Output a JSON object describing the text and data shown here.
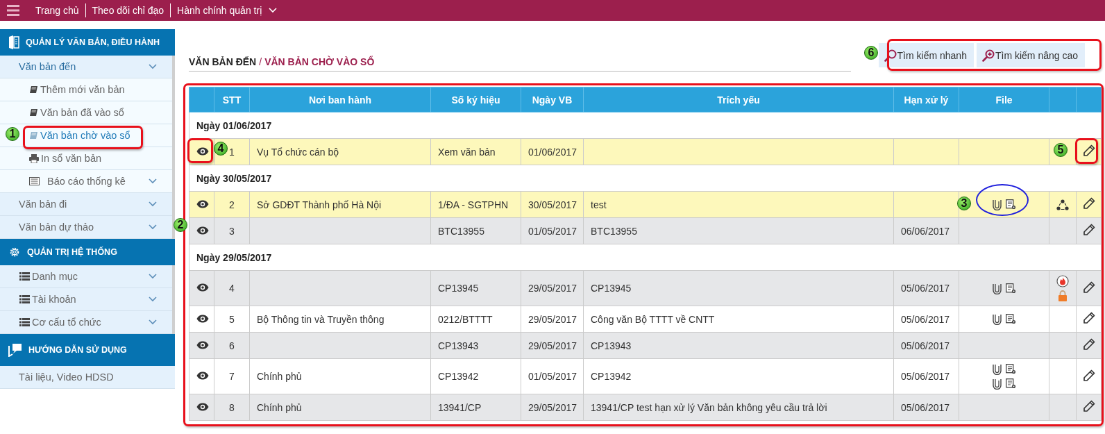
{
  "topbar": {
    "menu_items": [
      {
        "label": "Trang chủ",
        "dropdown": false
      },
      {
        "label": "Theo dõi chỉ đạo",
        "dropdown": false
      },
      {
        "label": "Hành chính quản trị",
        "dropdown": true
      }
    ]
  },
  "sidebar": {
    "sections": [
      {
        "kind": "documents",
        "title": "QUẢN LÝ VĂN BẢN, ĐIỀU HÀNH",
        "items": [
          {
            "label": "Văn bản đến",
            "kind": "plain",
            "expandable": true,
            "expanded": true,
            "selected": false,
            "children": [
              {
                "label": "Thêm mới văn bản",
                "kind": "document",
                "expandable": false,
                "selected": false
              },
              {
                "label": "Văn bản đã vào sổ",
                "kind": "document",
                "expandable": false,
                "selected": false
              },
              {
                "label": "Văn bản chờ vào sổ",
                "kind": "document",
                "expandable": false,
                "selected": true
              },
              {
                "label": "In sổ văn bản",
                "kind": "print",
                "expandable": false,
                "selected": false
              },
              {
                "label": "Báo cáo thống kê",
                "kind": "report",
                "expandable": true,
                "selected": false
              }
            ]
          },
          {
            "label": "Văn bản đi",
            "kind": "plain",
            "expandable": true,
            "expanded": false,
            "selected": false
          },
          {
            "label": "Văn bản dự thảo",
            "kind": "plain",
            "expandable": true,
            "expanded": false,
            "selected": false
          }
        ]
      },
      {
        "kind": "settings",
        "title": "QUẢN TRỊ HỆ THỐNG",
        "items": [
          {
            "label": "Danh mục",
            "kind": "list",
            "expandable": true,
            "expanded": false,
            "selected": false
          },
          {
            "label": "Tài khoản",
            "kind": "list",
            "expandable": true,
            "expanded": false,
            "selected": false
          },
          {
            "label": "Cơ cấu tổ chức",
            "kind": "list",
            "expandable": true,
            "expanded": false,
            "selected": false
          }
        ]
      },
      {
        "kind": "guide",
        "title": "HƯỚNG DẪN SỬ DỤNG",
        "items": [
          {
            "label": "Tài liệu, Video HDSD",
            "kind": "plain",
            "expandable": false,
            "expanded": false,
            "selected": false
          }
        ]
      }
    ]
  },
  "breadcrumb": {
    "parent": "VĂN BẢN ĐẾN",
    "separator": "/",
    "current": "VĂN BẢN CHỜ VÀO SỔ"
  },
  "search_buttons": [
    {
      "kind": "quick",
      "label": "Tìm kiếm nhanh"
    },
    {
      "kind": "advanced",
      "label": "Tìm kiếm nâng cao"
    }
  ],
  "table": {
    "columns": [
      "STT",
      "Nơi ban hành",
      "Số ký hiệu",
      "Ngày VB",
      "Trích yếu",
      "Hạn xử lý",
      "File"
    ],
    "groups": [
      {
        "date_label": "Ngày 01/06/2017",
        "rows": [
          {
            "stt": "1",
            "issuer": "Vụ Tổ chức cán bộ",
            "symbol": "Xem văn bản",
            "doc_date": "01/06/2017",
            "color": "#fdf8bb"
          }
        ]
      },
      {
        "date_label": "Ngày 30/05/2017",
        "rows": [
          {
            "stt": "2",
            "issuer": "Sở GDĐT Thành phố Hà Nội",
            "symbol": "1/ĐA - SGTPHN",
            "doc_date": "30/05/2017",
            "summary": "test",
            "files": [
              {
                "kind": "attachment"
              }
            ],
            "flags": [
              {
                "kind": "shared"
              }
            ],
            "color": "#fdf8bb"
          },
          {
            "stt": "3",
            "symbol": "BTC13955",
            "doc_date": "01/05/2017",
            "summary": "BTC13955",
            "deadline": "06/06/2017",
            "color": "#e6e7e9"
          }
        ]
      },
      {
        "date_label": "Ngày 29/05/2017",
        "rows": [
          {
            "stt": "4",
            "symbol": "CP13945",
            "doc_date": "29/05/2017",
            "summary": "CP13945",
            "deadline": "05/06/2017",
            "files": [
              {
                "kind": "attachment"
              }
            ],
            "flags": [
              {
                "kind": "urgent"
              },
              {
                "kind": "locked"
              }
            ],
            "color": "#e6e7e9"
          },
          {
            "stt": "5",
            "issuer": "Bộ Thông tin và Truyền thông",
            "symbol": "0212/BTTTT",
            "doc_date": "29/05/2017",
            "summary": "Công văn Bộ TTTT về CNTT",
            "deadline": "05/06/2017",
            "files": [
              {
                "kind": "attachment"
              }
            ],
            "color": "#ffffff"
          },
          {
            "stt": "6",
            "symbol": "CP13943",
            "doc_date": "29/05/2017",
            "summary": "CP13943",
            "deadline": "05/06/2017",
            "color": "#e6e7e9"
          },
          {
            "stt": "7",
            "issuer": "Chính phủ",
            "symbol": "CP13942",
            "doc_date": "01/05/2017",
            "summary": "CP13942",
            "deadline": "05/06/2017",
            "files": [
              {
                "kind": "attachment"
              },
              {
                "kind": "attachment"
              }
            ],
            "color": "#ffffff"
          },
          {
            "stt": "8",
            "issuer": "Chính phủ",
            "symbol": "13941/CP",
            "doc_date": "29/05/2017",
            "summary": "13941/CP test hạn xử lý Văn bản không yêu cầu trả lời",
            "deadline": "05/06/2017",
            "color": "#e6e7e9"
          }
        ]
      }
    ]
  },
  "callouts": [
    {
      "number": "1"
    },
    {
      "number": "2"
    },
    {
      "number": "3"
    },
    {
      "number": "4"
    },
    {
      "number": "5"
    },
    {
      "number": "6"
    }
  ]
}
